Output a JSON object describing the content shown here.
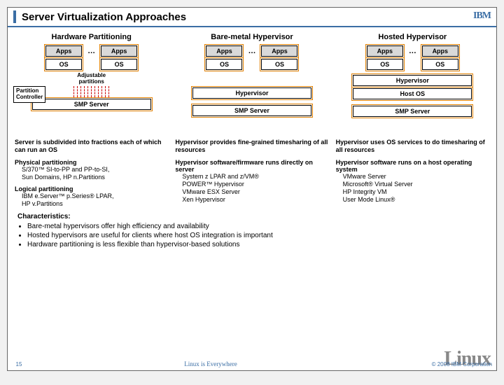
{
  "header": {
    "title": "Server Virtualization Approaches",
    "logo": "IBM"
  },
  "cols": [
    {
      "heading": "Hardware Partitioning",
      "apps": "Apps",
      "os": "OS",
      "dots": "…",
      "adjustable": "Adjustable\npartitions",
      "pc": "Partition\nController",
      "server": "SMP Server",
      "desc1": "Server is subdivided into fractions each of which can run an OS",
      "sec1h": "Physical partitioning",
      "sec1b": "S/370™ SI-to-PP and PP-to-SI,\nSun Domains, HP n.Partitions",
      "sec2h": "Logical partitioning",
      "sec2b": "IBM e.Server™ p.Series® LPAR,\nHP v.Partitions"
    },
    {
      "heading": "Bare-metal Hypervisor",
      "apps": "Apps",
      "os": "OS",
      "dots": "…",
      "hyp": "Hypervisor",
      "server": "SMP Server",
      "desc1": "Hypervisor provides fine-grained timesharing of all resources",
      "sec1h": "Hypervisor software/firmware runs directly on server",
      "sec1b": "System z LPAR and z/VM®\nPOWER™ Hypervisor\nVMware ESX Server\nXen Hypervisor"
    },
    {
      "heading": "Hosted Hypervisor",
      "apps": "Apps",
      "os": "OS",
      "dots": "…",
      "hyp": "Hypervisor",
      "host": "Host OS",
      "server": "SMP Server",
      "desc1": "Hypervisor uses OS services to do timesharing of all resources",
      "sec1h": "Hypervisor software runs on a host operating system",
      "sec1b": "VMware Server\nMicrosoft® Virtual Server\nHP Integrity VM\nUser Mode Linux®"
    }
  ],
  "characteristics": {
    "heading": "Characteristics:",
    "items": [
      "Bare-metal hypervisors offer high efficiency and availability",
      "Hosted hypervisors are useful for clients where host OS integration is important",
      "Hardware partitioning is less flexible than hypervisor-based solutions"
    ]
  },
  "footer": {
    "page": "15",
    "center": "Linux is Everywhere",
    "copy": "© 2008 IBM Corporation",
    "logo": "Linux"
  }
}
